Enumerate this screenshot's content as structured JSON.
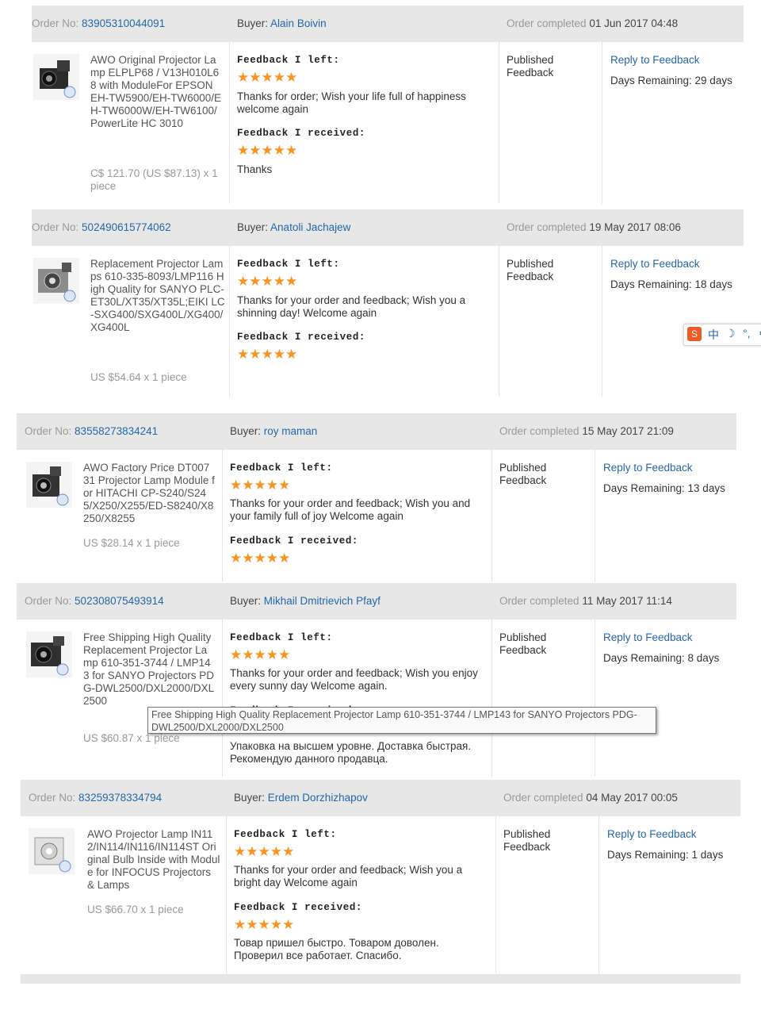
{
  "labels": {
    "order_no": "Order No:",
    "buyer": "Buyer:",
    "order_completed": "Order completed",
    "feedback_left": "Feedback I left:",
    "feedback_received": "Feedback I received:",
    "published_feedback": "Published Feedback",
    "reply_to_feedback": "Reply to Feedback",
    "stars": "★★★★★"
  },
  "orders": [
    {
      "order_no": "83905310044091",
      "buyer": "Alain Boivin",
      "completed": "01 Jun 2017 04:48",
      "product_title": "AWO Original Projector Lamp ELPLP68 / V13H010L68 with ModuleFor EPSON EH-TW5900/EH-TW6000/EH-TW6000W/EH-TW6100/PowerLite HC 3010",
      "price": "C$ 121.70 (US $87.13) x 1 piece",
      "feedback_left": "Thanks for order; Wish your life full of happiness welcome again",
      "feedback_received": "Thanks",
      "days_remaining": "Days Remaining: 29 days"
    },
    {
      "order_no": "502490615774062",
      "buyer": "Anatoli Jachajew",
      "completed": "19 May 2017 08:06",
      "product_title": "Replacement Projector Lamps 610-335-8093/LMP116 High Quality for SANYO PLC-ET30L/XT35/XT35L;EIKI LC-SXG400/SXG400L/XG400/XG400L",
      "price": "US $54.64 x 1 piece",
      "feedback_left": "Thanks for your order and feedback; Wish you a shinning day! Welcome again",
      "feedback_received": "",
      "days_remaining": "Days Remaining: 18 days"
    },
    {
      "order_no": "83558273834241",
      "buyer": "roy maman",
      "completed": "15 May 2017 21:09",
      "product_title": "AWO Factory Price DT00731 Projector Lamp Module for HITACHI CP-S240/S245/X250/X255/ED-S8240/X8250/X8255",
      "price": "US $28.14 x 1 piece",
      "feedback_left": "Thanks for your order and feedback; Wish you and your family full of joy Welcome again",
      "feedback_received": "",
      "days_remaining": "Days Remaining: 13 days"
    },
    {
      "order_no": "502308075493914",
      "buyer": "Mikhail Dmitrievich Pfayf",
      "completed": "11 May 2017 11:14",
      "product_title": "Free Shipping High Quality Replacement Projector Lamp 610-351-3744 / LMP143 for SANYO Projectors PDG-DWL2500/DXL2000/DXL2500",
      "price": "US $60.87 x 1 piece",
      "feedback_left": "Thanks for your order and feedback; Wish you enjoy every sunny day Welcome again.",
      "feedback_received": "Упаковка на высшем уровне. Доставка быстрая. Рекомендую данного продавца.",
      "days_remaining": "Days Remaining: 8 days"
    },
    {
      "order_no": "83259378334794",
      "buyer": "Erdem Dorzhizhapov",
      "completed": "04 May 2017 00:05",
      "product_title": "AWO Projector Lamp IN112/IN114/IN116/IN114ST Original Bulb Inside with Module for INFOCUS Projectors & Lamps",
      "price": "US $66.70 x 1 piece",
      "feedback_left": "Thanks for your order and feedback; Wish you a bright day Welcome again",
      "feedback_received": "Товар пришел быстро. Товаром доволен. Проверил все работает. Спасибо.",
      "days_remaining": "Days Remaining: 1 days"
    }
  ],
  "tooltip": "Free Shipping High Quality Replacement Projector Lamp 610-351-3744 / LMP143 for SANYO Projectors PDG-DWL2500/DXL2000/DXL2500",
  "ime_toolbar": {
    "lang": "中",
    "icons": [
      "ime-logo-icon",
      "moon-icon",
      "punctuation-icon"
    ]
  }
}
